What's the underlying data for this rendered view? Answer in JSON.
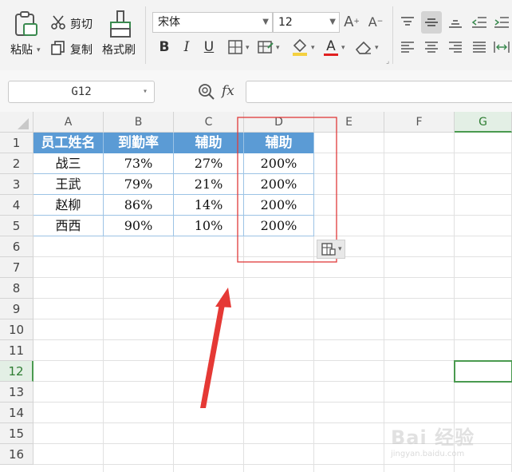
{
  "ribbon": {
    "paste_label": "粘贴",
    "cut_label": "剪切",
    "copy_label": "复制",
    "format_painter_label": "格式刷",
    "font_name": "宋体",
    "font_size": "12",
    "bold": "B",
    "italic": "I",
    "underline": "U",
    "font_color_glyph": "A",
    "fill_color": "#f4d03f",
    "font_color": "#e02020"
  },
  "formula_bar": {
    "name_box": "G12",
    "fx_label": "fx",
    "formula_value": ""
  },
  "sheet": {
    "columns": [
      "A",
      "B",
      "C",
      "D",
      "E",
      "F",
      "G"
    ],
    "rows": [
      "1",
      "2",
      "3",
      "4",
      "5",
      "6",
      "7",
      "8",
      "9",
      "10",
      "11",
      "12",
      "13",
      "14",
      "15",
      "16"
    ],
    "selected_cell": "G12",
    "header_row": [
      "员工姓名",
      "到勤率",
      "辅助",
      "辅助"
    ],
    "data_rows": [
      [
        "战三",
        "73%",
        "27%",
        "200%"
      ],
      [
        "王武",
        "79%",
        "21%",
        "200%"
      ],
      [
        "赵柳",
        "86%",
        "14%",
        "200%"
      ],
      [
        "西西",
        "90%",
        "10%",
        "200%"
      ]
    ],
    "header_fill": "#5b9bd5",
    "selection_color": "#4a9a4f"
  },
  "annotation": {
    "box_color": "#e03a3a",
    "arrow_color": "#e53935"
  },
  "watermark": {
    "brand": "Bai 经验",
    "url": "jingyan.baidu.com"
  }
}
